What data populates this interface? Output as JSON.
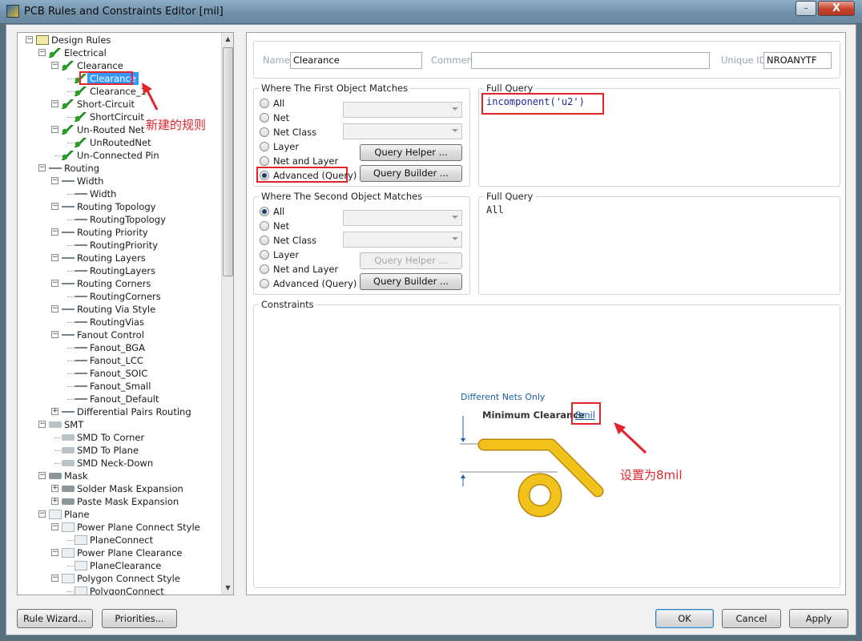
{
  "window": {
    "title": "PCB Rules and Constraints Editor [mil]",
    "minimize": "–",
    "close": "X"
  },
  "tree": {
    "items": [
      {
        "label": "Design Rules"
      },
      {
        "label": "Electrical"
      },
      {
        "label": "Clearance"
      },
      {
        "label": "Clearance"
      },
      {
        "label": "Clearance_1"
      },
      {
        "label": "Short-Circuit"
      },
      {
        "label": "ShortCircuit"
      },
      {
        "label": "Un-Routed Net"
      },
      {
        "label": "UnRoutedNet"
      },
      {
        "label": "Un-Connected Pin"
      },
      {
        "label": "Routing"
      },
      {
        "label": "Width"
      },
      {
        "label": "Width"
      },
      {
        "label": "Routing Topology"
      },
      {
        "label": "RoutingTopology"
      },
      {
        "label": "Routing Priority"
      },
      {
        "label": "RoutingPriority"
      },
      {
        "label": "Routing Layers"
      },
      {
        "label": "RoutingLayers"
      },
      {
        "label": "Routing Corners"
      },
      {
        "label": "RoutingCorners"
      },
      {
        "label": "Routing Via Style"
      },
      {
        "label": "RoutingVias"
      },
      {
        "label": "Fanout Control"
      },
      {
        "label": "Fanout_BGA"
      },
      {
        "label": "Fanout_LCC"
      },
      {
        "label": "Fanout_SOIC"
      },
      {
        "label": "Fanout_Small"
      },
      {
        "label": "Fanout_Default"
      },
      {
        "label": "Differential Pairs Routing"
      },
      {
        "label": "SMT"
      },
      {
        "label": "SMD To Corner"
      },
      {
        "label": "SMD To Plane"
      },
      {
        "label": "SMD Neck-Down"
      },
      {
        "label": "Mask"
      },
      {
        "label": "Solder Mask Expansion"
      },
      {
        "label": "Paste Mask Expansion"
      },
      {
        "label": "Plane"
      },
      {
        "label": "Power Plane Connect Style"
      },
      {
        "label": "PlaneConnect"
      },
      {
        "label": "Power Plane Clearance"
      },
      {
        "label": "PlaneClearance"
      },
      {
        "label": "Polygon Connect Style"
      },
      {
        "label": "PolygonConnect"
      }
    ]
  },
  "rule": {
    "name_label": "Name",
    "name_value": "Clearance",
    "comment_label": "Comment",
    "comment_value": "",
    "uid_label": "Unique ID",
    "uid_value": "NROANYTF"
  },
  "first": {
    "title": "Where The First Object Matches",
    "options": [
      "All",
      "Net",
      "Net Class",
      "Layer",
      "Net and Layer",
      "Advanced (Query)"
    ],
    "selected": "Advanced (Query)",
    "helper": "Query Helper ...",
    "builder": "Query Builder ...",
    "query_title": "Full Query",
    "query": "incomponent('u2')"
  },
  "second": {
    "title": "Where The Second Object Matches",
    "options": [
      "All",
      "Net",
      "Net Class",
      "Layer",
      "Net and Layer",
      "Advanced (Query)"
    ],
    "selected": "All",
    "helper": "Query Helper ...",
    "builder": "Query Builder ...",
    "query_title": "Full Query",
    "query": "All"
  },
  "constraints": {
    "title": "Constraints",
    "diff_nets": "Different Nets Only",
    "min_label": "Minimum Clearance",
    "min_value": "8mil"
  },
  "annotations": {
    "new_rule": "新建的规则",
    "set_to": "设置为8mil",
    "color": "#e0262b"
  },
  "footer": {
    "rule_wizard": "Rule Wizard...",
    "priorities": "Priorities...",
    "ok": "OK",
    "cancel": "Cancel",
    "apply": "Apply"
  },
  "colors": {
    "selection": "#3399ff",
    "trace": "#f2c21c",
    "query_blue": "#1d2a9a"
  }
}
